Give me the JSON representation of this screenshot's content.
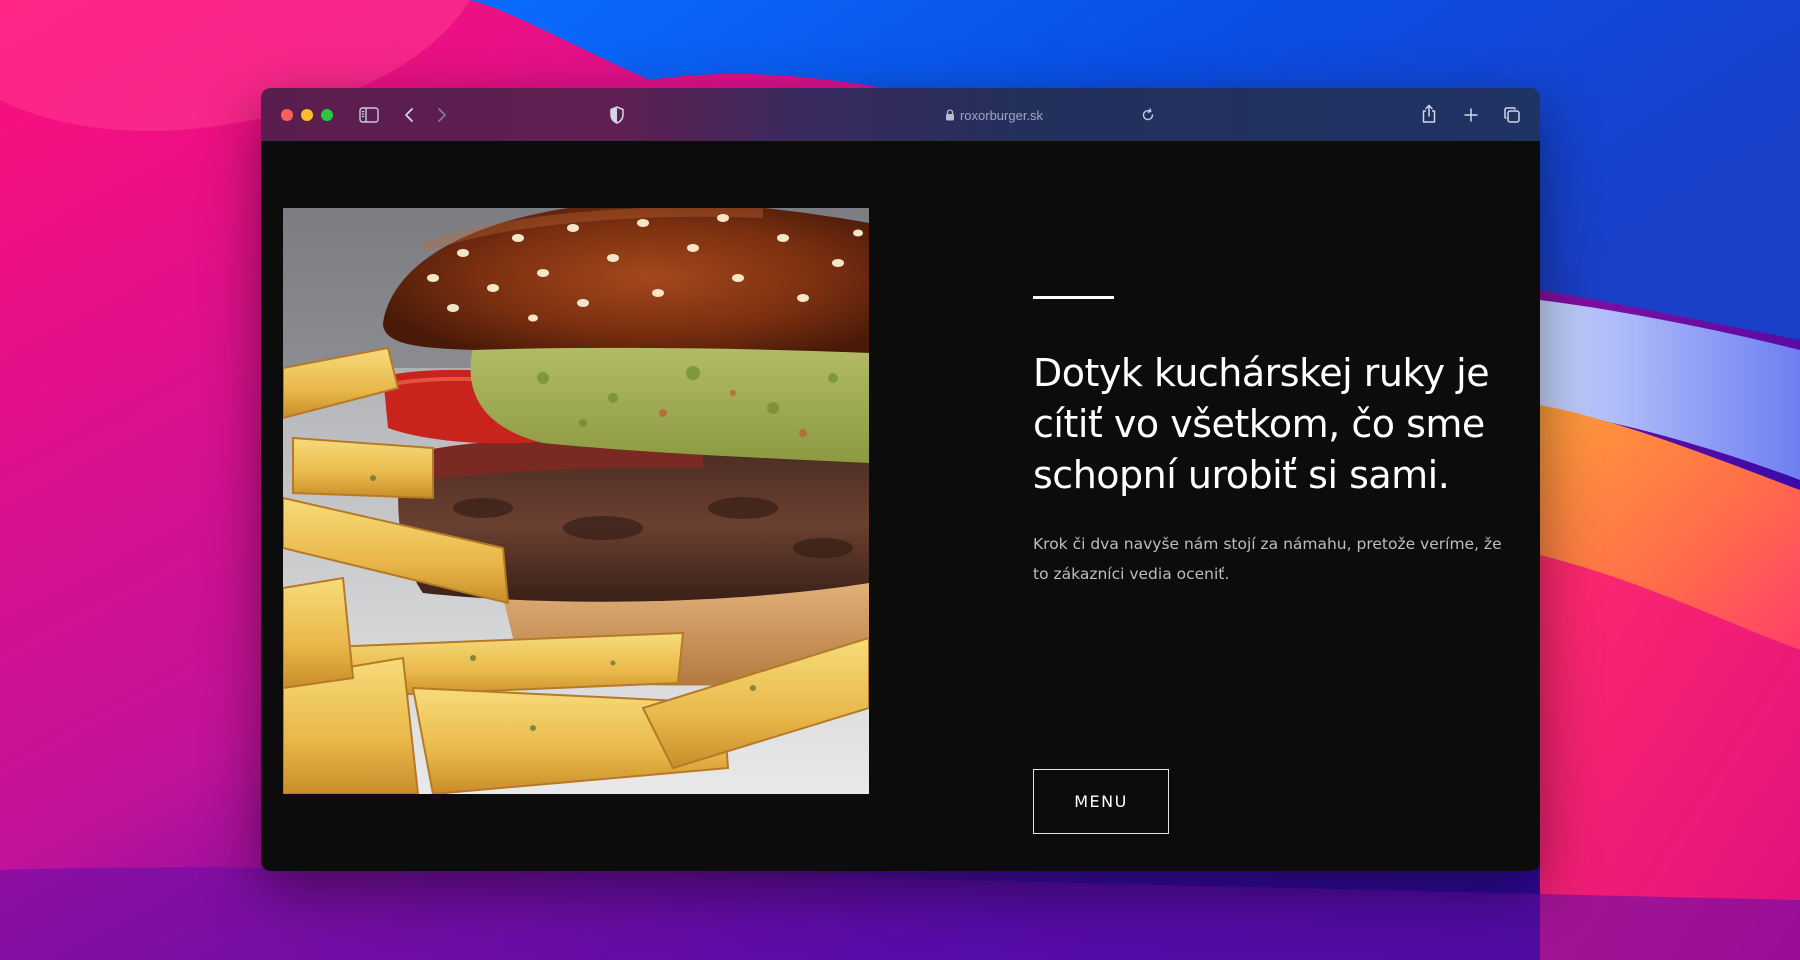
{
  "browser": {
    "address": "roxorburger.sk",
    "icons": {
      "sidebar": "sidebar-icon",
      "back": "chevron-left-icon",
      "forward": "chevron-right-icon",
      "privacy": "shield-icon",
      "lock": "lock-icon",
      "reload": "reload-icon",
      "share": "share-icon",
      "new_tab": "plus-icon",
      "tabs": "tabs-overview-icon"
    },
    "colors": {
      "close": "#ff5f57",
      "minimize": "#febc2e",
      "zoom": "#28c840"
    }
  },
  "page": {
    "image_subject": "burger-with-fries-photo",
    "headline": "Dotyk kuchárskej ruky je cítiť vo všetkom, čo sme schopní urobiť si sami.",
    "subtext": "Krok či dva navyše nám stojí za námahu, pretože veríme, že to zákazníci vedia oceniť.",
    "menu_button": "MENU",
    "colors": {
      "background": "#0c0c0c",
      "text": "#ffffff",
      "muted_text": "#bdbdbd"
    }
  }
}
